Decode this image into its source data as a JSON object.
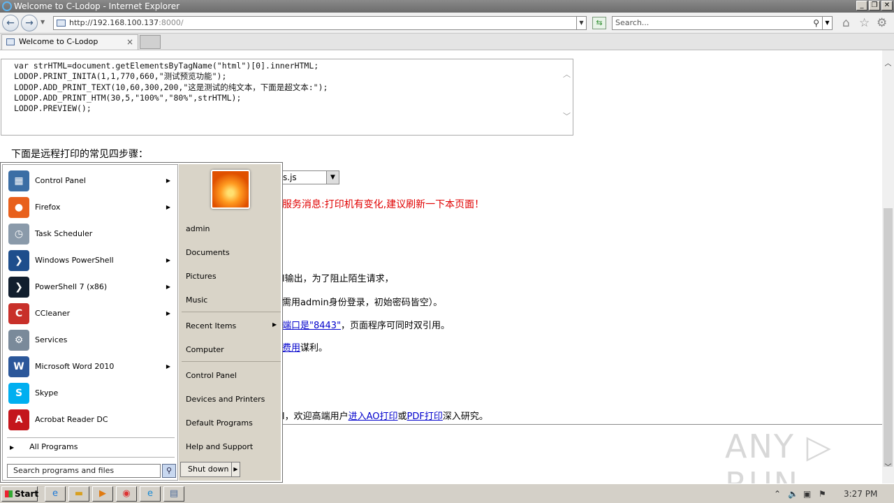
{
  "window": {
    "title": "Welcome to C-Lodop - Internet Explorer",
    "minimize": "_",
    "restore": "❐",
    "close": "✕"
  },
  "nav": {
    "back_icon": "back-arrow-icon",
    "forward_icon": "forward-arrow-icon",
    "url_main": "http://192.168.100.137",
    "url_port": ":8000/",
    "search_placeholder": "Search...",
    "tool_icons": [
      "home-icon",
      "star-icon",
      "gear-icon"
    ]
  },
  "tab": {
    "label": "Welcome to C-Lodop",
    "close": "×"
  },
  "page": {
    "code_lines": [
      "var strHTML=document.getElementsByTagName(\"html\")[0].innerHTML;",
      "LODOP.PRINT_INITA(1,1,770,660,\"测试预览功能\");",
      "LODOP.ADD_PRINT_TEXT(10,60,300,200,\"这是测试的纯文本，下面是超文本:\");",
      "LODOP.ADD_PRINT_HTM(30,5,\"100%\",\"80%\",strHTML);",
      "LODOP.PREVIEW();"
    ],
    "heading": "下面是远程打印的常见四步骤：",
    "select_value": "s.js",
    "warning": "服务消息:打印机有变化,建议刷新一下本页面！",
    "line1": "l输出，为了阻止陌生请求，",
    "line2": "需用admin身份登录，初始密码皆空）。",
    "line3_link": "端口是\"8443\"",
    "line3_rest": "，页面程序可同时双引用。",
    "line4_link": "费用",
    "line4_rest": "谋利。",
    "line5_pre": "l，欢迎高端用户",
    "line5_link1": "进入AO打印",
    "line5_mid": "或",
    "line5_link2": "PDF打印",
    "line5_post": "深入研究。",
    "watermark": "ANY ▷ RUN"
  },
  "start_menu": {
    "left_items": [
      {
        "label": "Control Panel",
        "icon": "control-panel-icon",
        "color": "#3b6ea5",
        "glyph": "▦",
        "submenu": true
      },
      {
        "label": "Firefox",
        "icon": "firefox-icon",
        "color": "#e8601c",
        "glyph": "●",
        "submenu": true
      },
      {
        "label": "Task Scheduler",
        "icon": "clock-icon",
        "color": "#8a9aaa",
        "glyph": "◷",
        "submenu": false
      },
      {
        "label": "Windows PowerShell",
        "icon": "powershell-icon",
        "color": "#1e4e8c",
        "glyph": "❯",
        "submenu": true
      },
      {
        "label": "PowerShell 7 (x86)",
        "icon": "powershell7-icon",
        "color": "#111e2e",
        "glyph": "❯",
        "submenu": true
      },
      {
        "label": "CCleaner",
        "icon": "ccleaner-icon",
        "color": "#c8302a",
        "glyph": "C",
        "submenu": true
      },
      {
        "label": "Services",
        "icon": "services-gear-icon",
        "color": "#7a8a9a",
        "glyph": "⚙",
        "submenu": false
      },
      {
        "label": "Microsoft Word 2010",
        "icon": "word-icon",
        "color": "#2b579a",
        "glyph": "W",
        "submenu": true
      },
      {
        "label": "Skype",
        "icon": "skype-icon",
        "color": "#00aff0",
        "glyph": "S",
        "submenu": false
      },
      {
        "label": "Acrobat Reader DC",
        "icon": "acrobat-icon",
        "color": "#c4161c",
        "glyph": "A",
        "submenu": false
      }
    ],
    "all_programs": "All Programs",
    "search_placeholder": "Search programs and files",
    "right_items": {
      "user": "admin",
      "documents": "Documents",
      "pictures": "Pictures",
      "music": "Music",
      "recent": "Recent Items",
      "computer": "Computer",
      "control_panel": "Control Panel",
      "devices": "Devices and Printers",
      "defaults": "Default Programs",
      "help": "Help and Support"
    },
    "shutdown": "Shut down"
  },
  "taskbar": {
    "start": "Start",
    "clock": "3:27 PM"
  }
}
